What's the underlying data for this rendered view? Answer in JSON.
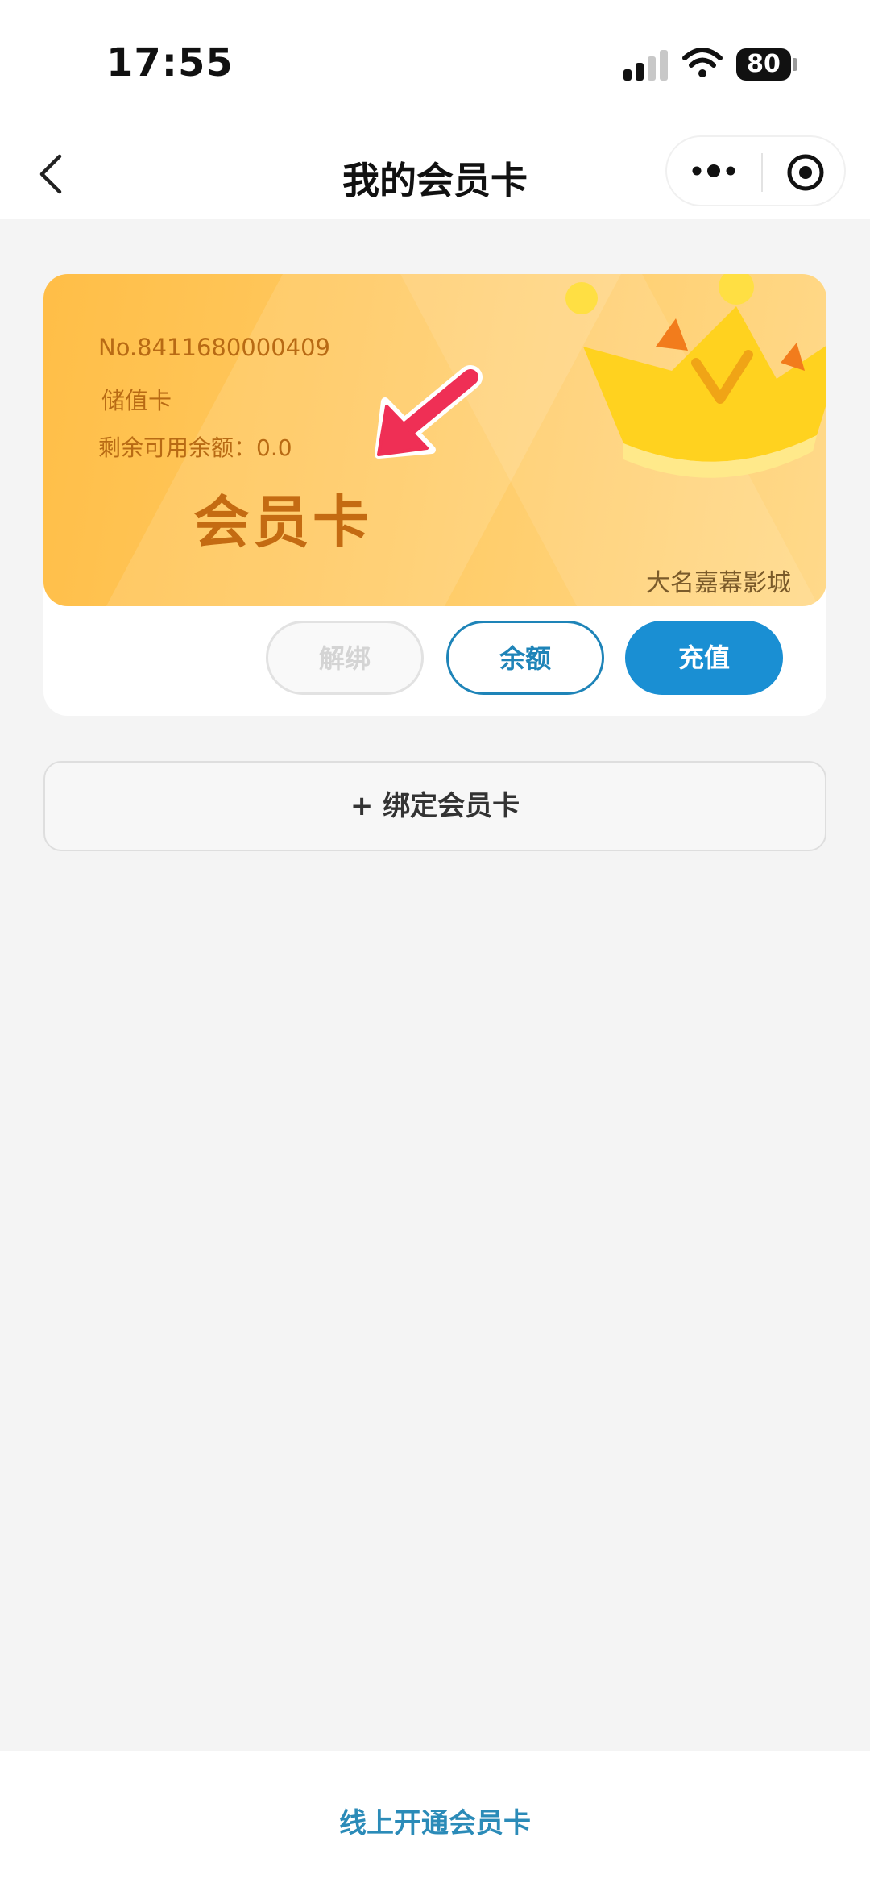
{
  "status_bar": {
    "time": "17:55",
    "battery": "80"
  },
  "nav": {
    "title": "我的会员卡"
  },
  "card": {
    "number": "No.8411680000409",
    "type": "储值卡",
    "balance_line": "剩余可用余额：0.0",
    "name": "会员卡",
    "cinema": "大名嘉幕影城"
  },
  "actions": {
    "unbind": "解绑",
    "balance": "余额",
    "recharge": "充值"
  },
  "bind_card": "+ 绑定会员卡",
  "bottom": {
    "open_online": "线上开通会员卡"
  },
  "colors": {
    "accent_blue": "#1a8fd3",
    "card_orange": "#ffc04d",
    "annotation_arrow": "#ef2f55"
  }
}
